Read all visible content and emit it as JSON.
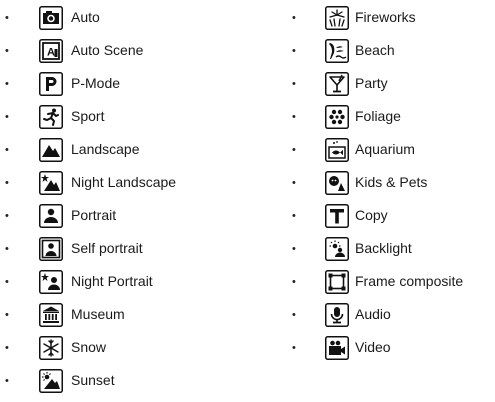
{
  "bullet": "•",
  "left_list": [
    {
      "label": "Auto",
      "icon": "camera-icon"
    },
    {
      "label": "Auto Scene",
      "icon": "auto-scene-icon"
    },
    {
      "label": "P-Mode",
      "icon": "p-mode-icon"
    },
    {
      "label": "Sport",
      "icon": "sport-icon"
    },
    {
      "label": "Landscape",
      "icon": "landscape-icon"
    },
    {
      "label": "Night Landscape",
      "icon": "night-landscape-icon"
    },
    {
      "label": "Portrait",
      "icon": "portrait-icon"
    },
    {
      "label": "Self portrait",
      "icon": "self-portrait-icon"
    },
    {
      "label": "Night Portrait",
      "icon": "night-portrait-icon"
    },
    {
      "label": "Museum",
      "icon": "museum-icon"
    },
    {
      "label": "Snow",
      "icon": "snow-icon"
    },
    {
      "label": "Sunset",
      "icon": "sunset-icon"
    }
  ],
  "right_list": [
    {
      "label": "Fireworks",
      "icon": "fireworks-icon"
    },
    {
      "label": "Beach",
      "icon": "beach-icon"
    },
    {
      "label": "Party",
      "icon": "party-icon"
    },
    {
      "label": "Foliage",
      "icon": "foliage-icon"
    },
    {
      "label": "Aquarium",
      "icon": "aquarium-icon"
    },
    {
      "label": "Kids & Pets",
      "icon": "kids-pets-icon"
    },
    {
      "label": "Copy",
      "icon": "copy-icon"
    },
    {
      "label": "Backlight",
      "icon": "backlight-icon"
    },
    {
      "label": "Frame composite",
      "icon": "frame-composite-icon"
    },
    {
      "label": "Audio",
      "icon": "audio-icon"
    },
    {
      "label": "Video",
      "icon": "video-icon"
    }
  ]
}
